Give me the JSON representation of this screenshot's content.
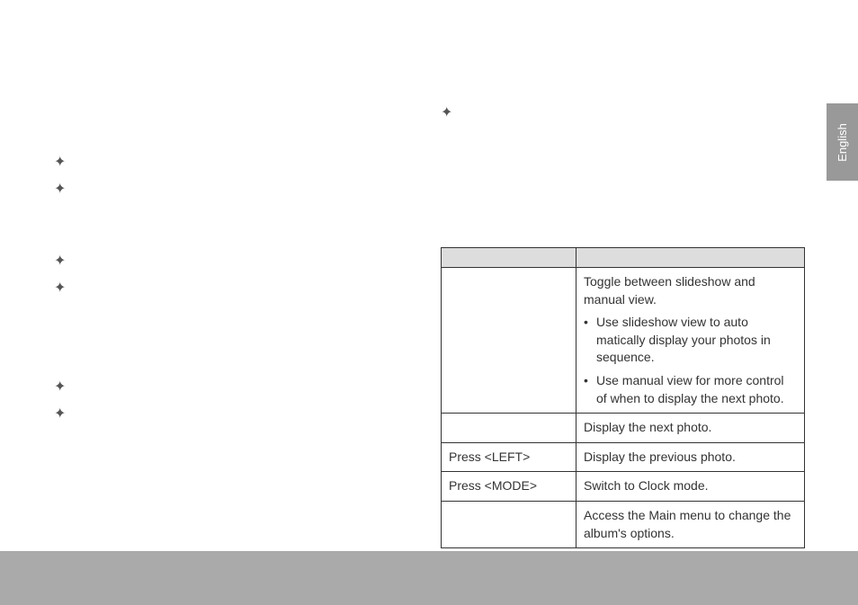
{
  "language_tab": "English",
  "table": {
    "rows": [
      {
        "action": "",
        "description": "Toggle between slideshow and manual view.",
        "sub_items": [
          "Use slideshow view to auto matically display your photos in sequence.",
          "Use manual view for more control of when to display the next photo."
        ]
      },
      {
        "action": "",
        "description": "Display the next photo."
      },
      {
        "action": "Press <LEFT>",
        "description": "Display the previous photo."
      },
      {
        "action": "Press <MODE>",
        "description": "Switch to Clock mode."
      },
      {
        "action": "",
        "description": "Access the Main menu to change the album's options."
      }
    ]
  }
}
